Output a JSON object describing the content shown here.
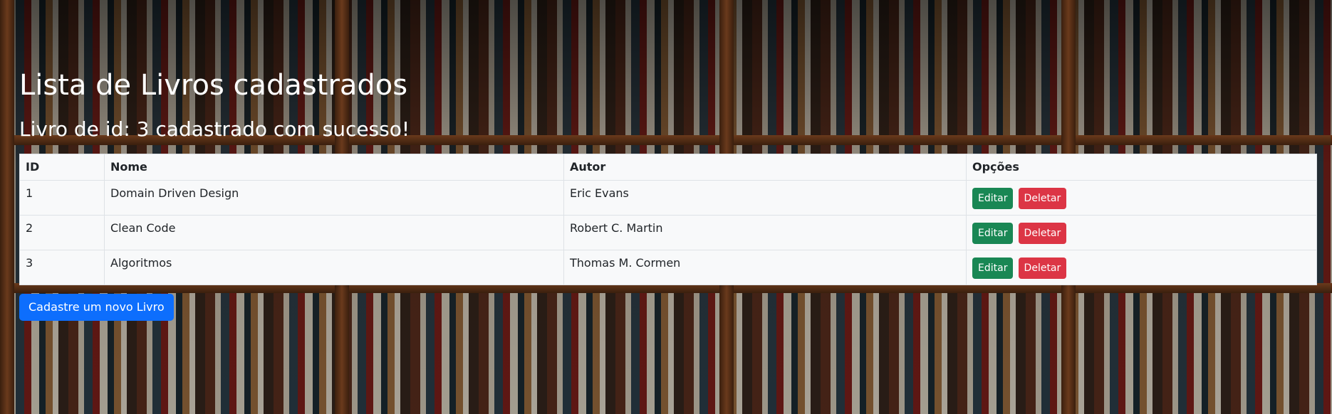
{
  "page": {
    "title": "Lista de Livros cadastrados",
    "message": "Livro de id: 3 cadastrado com sucesso!"
  },
  "table": {
    "headers": [
      "ID",
      "Nome",
      "Autor",
      "Opções"
    ],
    "rows": [
      {
        "id": "1",
        "nome": "Domain Driven Design",
        "autor": "Eric Evans"
      },
      {
        "id": "2",
        "nome": "Clean Code",
        "autor": "Robert C. Martin"
      },
      {
        "id": "3",
        "nome": "Algoritmos",
        "autor": "Thomas M. Cormen"
      }
    ],
    "edit_label": "Editar",
    "delete_label": "Deletar"
  },
  "actions": {
    "new_book_label": "Cadastre um novo Livro"
  },
  "colors": {
    "edit": "#198754",
    "delete": "#dc3545",
    "primary": "#0d6efd",
    "table_bg": "#f8f9fa"
  }
}
